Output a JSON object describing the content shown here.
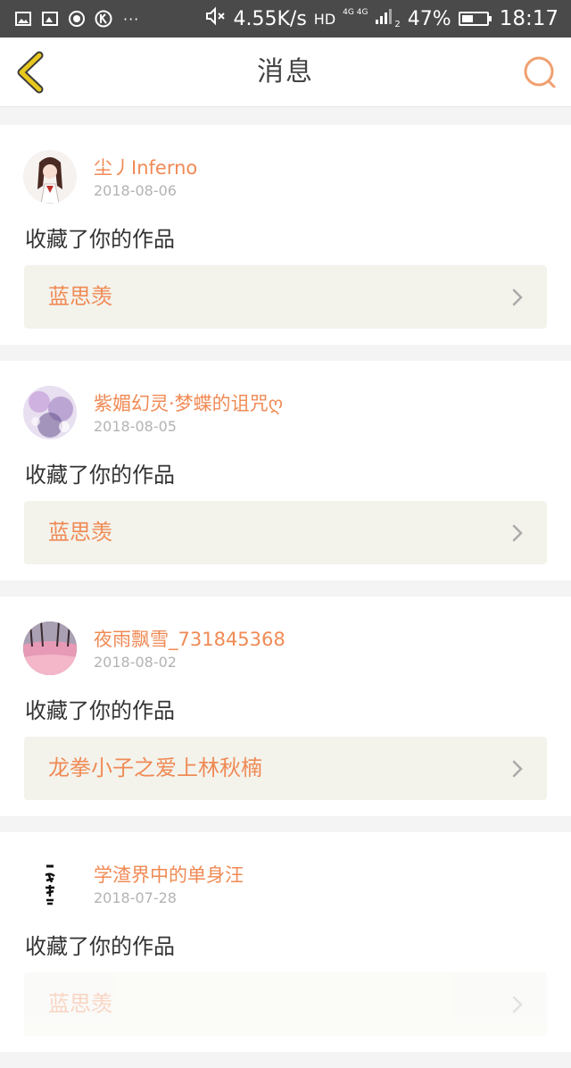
{
  "status_bar": {
    "net_speed": "4.55K/s",
    "hd": "HD",
    "network": "4G 4G",
    "sim": "2",
    "battery": "47%",
    "battery_level": 0.47,
    "time": "18:17",
    "more": "···"
  },
  "nav": {
    "title": "消息",
    "back_icon": "back-chevron-icon",
    "search_icon": "search-icon"
  },
  "colors": {
    "accent": "#f08a55",
    "back_yellow": "#e8c81e",
    "card_box": "#f3f3ec"
  },
  "messages": [
    {
      "user": "尘丿Inferno",
      "date": "2018-08-06",
      "action": "收藏了你的作品",
      "work": "蓝思羡"
    },
    {
      "user": "紫媚幻灵·梦蝶的诅咒ღ",
      "date": "2018-08-05",
      "action": "收藏了你的作品",
      "work": "蓝思羡"
    },
    {
      "user": "夜雨飘雪_731845368",
      "date": "2018-08-02",
      "action": "收藏了你的作品",
      "work": "龙拳小子之爱上林秋楠"
    },
    {
      "user": "学渣界中的单身汪",
      "date": "2018-07-28",
      "action": "收藏了你的作品",
      "work": "蓝思羡"
    }
  ]
}
